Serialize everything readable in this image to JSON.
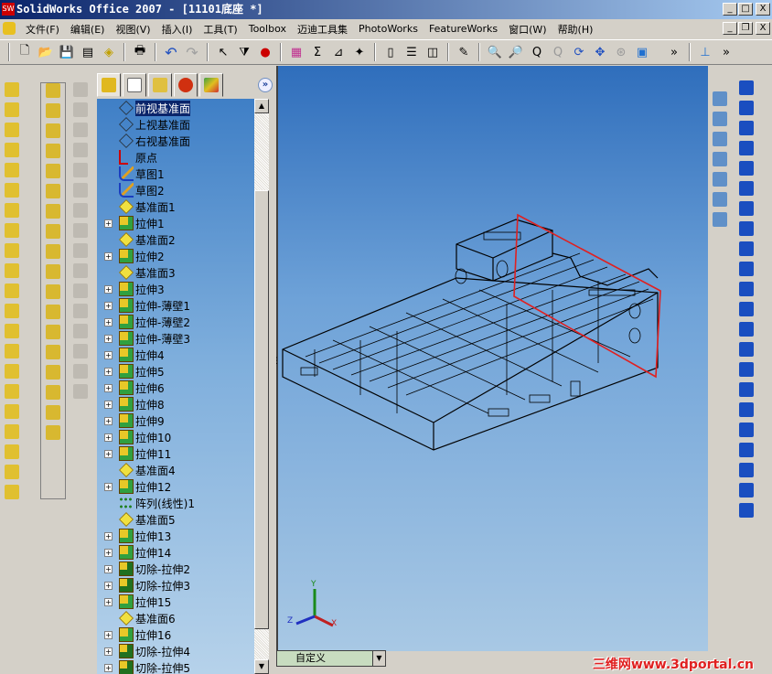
{
  "window": {
    "title": "SolidWorks Office 2007 - [11101底座 *]",
    "app_icon": "SW"
  },
  "menu": [
    "文件(F)",
    "编辑(E)",
    "视图(V)",
    "插入(I)",
    "工具(T)",
    "Toolbox",
    "迈迪工具集",
    "PhotoWorks",
    "FeatureWorks",
    "窗口(W)",
    "帮助(H)"
  ],
  "window_buttons": {
    "minimize": "_",
    "maximize": "□",
    "close": "X",
    "restore": "❐"
  },
  "tree": {
    "items": [
      {
        "label": "前视基准面",
        "icon": "plane",
        "exp": false,
        "selected": true
      },
      {
        "label": "上视基准面",
        "icon": "plane",
        "exp": false
      },
      {
        "label": "右视基准面",
        "icon": "plane",
        "exp": false
      },
      {
        "label": "原点",
        "icon": "origin",
        "exp": false
      },
      {
        "label": "草图1",
        "icon": "sketch",
        "exp": false
      },
      {
        "label": "草图2",
        "icon": "sketch",
        "exp": false
      },
      {
        "label": "基准面1",
        "icon": "refplane",
        "exp": false
      },
      {
        "label": "拉伸1",
        "icon": "extrude",
        "exp": true
      },
      {
        "label": "基准面2",
        "icon": "refplane",
        "exp": false
      },
      {
        "label": "拉伸2",
        "icon": "extrude",
        "exp": true
      },
      {
        "label": "基准面3",
        "icon": "refplane",
        "exp": false
      },
      {
        "label": "拉伸3",
        "icon": "extrude",
        "exp": true
      },
      {
        "label": "拉伸-薄壁1",
        "icon": "extrude",
        "exp": true
      },
      {
        "label": "拉伸-薄壁2",
        "icon": "extrude",
        "exp": true
      },
      {
        "label": "拉伸-薄壁3",
        "icon": "extrude",
        "exp": true
      },
      {
        "label": "拉伸4",
        "icon": "extrude",
        "exp": true
      },
      {
        "label": "拉伸5",
        "icon": "extrude",
        "exp": true
      },
      {
        "label": "拉伸6",
        "icon": "extrude",
        "exp": true
      },
      {
        "label": "拉伸8",
        "icon": "extrude",
        "exp": true
      },
      {
        "label": "拉伸9",
        "icon": "extrude",
        "exp": true
      },
      {
        "label": "拉伸10",
        "icon": "extrude",
        "exp": true
      },
      {
        "label": "拉伸11",
        "icon": "extrude",
        "exp": true
      },
      {
        "label": "基准面4",
        "icon": "refplane",
        "exp": false
      },
      {
        "label": "拉伸12",
        "icon": "extrude",
        "exp": true
      },
      {
        "label": "阵列(线性)1",
        "icon": "pattern",
        "exp": false
      },
      {
        "label": "基准面5",
        "icon": "refplane",
        "exp": false
      },
      {
        "label": "拉伸13",
        "icon": "extrude",
        "exp": true
      },
      {
        "label": "拉伸14",
        "icon": "extrude",
        "exp": true
      },
      {
        "label": "切除-拉伸2",
        "icon": "cut",
        "exp": true
      },
      {
        "label": "切除-拉伸3",
        "icon": "cut",
        "exp": true
      },
      {
        "label": "拉伸15",
        "icon": "extrude",
        "exp": true
      },
      {
        "label": "基准面6",
        "icon": "refplane",
        "exp": false
      },
      {
        "label": "拉伸16",
        "icon": "extrude",
        "exp": true
      },
      {
        "label": "切除-拉伸4",
        "icon": "cut",
        "exp": true
      },
      {
        "label": "切除-拉伸5",
        "icon": "cut",
        "exp": true
      }
    ]
  },
  "view": {
    "orientation_combo": "自定义",
    "triad": {
      "x": "X",
      "y": "Y",
      "z": "Z"
    }
  },
  "watermark": "三维网www.3dportal.cn",
  "colors": {
    "selection": "#0a246a",
    "section_plane": "#e02020"
  }
}
